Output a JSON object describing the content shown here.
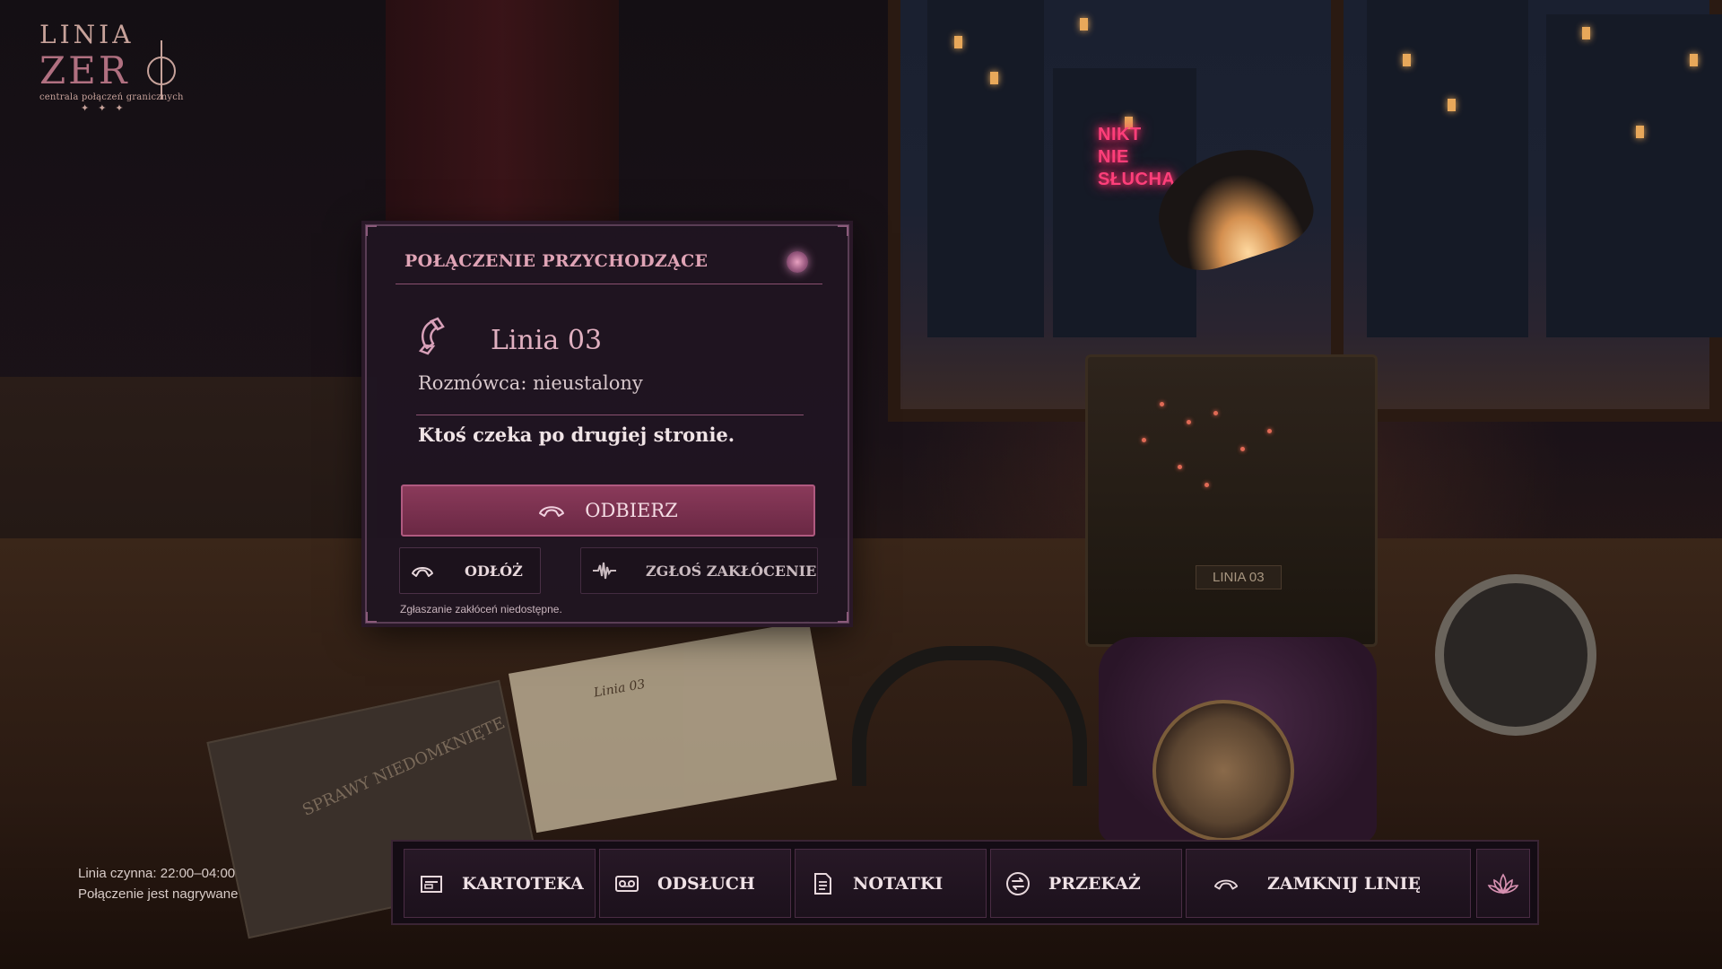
{
  "logo": {
    "line1": "LINIA",
    "line2": "ZER",
    "subtitle": "centrala połączeń granicznych",
    "stars": "✦✦✦"
  },
  "scene": {
    "neon_sign": [
      "NIKT",
      "NIE",
      "SŁUCHA"
    ],
    "switchboard_label": "LINIA 03",
    "paper_title": "Linia 03",
    "book_title": "SPRAWY NIEDOMKNIĘTE"
  },
  "dialog": {
    "title": "POŁĄCZENIE PRZYCHODZĄCE",
    "line_name": "Linia 03",
    "caller": "Rozmówca: nieustalony",
    "message": "Ktoś czeka po drugiej stronie.",
    "answer_label": "ODBIERZ",
    "hangup_label": "ODŁÓŻ",
    "report_label": "ZGŁOŚ ZAKŁÓCENIE",
    "hint": "Zgłaszanie zakłóceń niedostępne."
  },
  "status": {
    "hours": "Linia czynna: 22:00–04:00",
    "recording": "Połączenie jest nagrywane"
  },
  "bottom_bar": {
    "items": [
      {
        "label": "KARTOTEKA",
        "icon": "card-file-icon"
      },
      {
        "label": "ODSŁUCH",
        "icon": "tape-icon"
      },
      {
        "label": "NOTATKI",
        "icon": "notes-icon"
      },
      {
        "label": "PRZEKAŻ",
        "icon": "transfer-icon"
      },
      {
        "label": "ZAMKNIJ LINIĘ",
        "icon": "hangup-icon"
      }
    ],
    "extra_icon": "lotus-icon"
  },
  "colors": {
    "accent": "#e0a4b6",
    "answer_button": "#7a3050",
    "panel_bg": "#1f1521",
    "neon": "#ff3f7a"
  }
}
